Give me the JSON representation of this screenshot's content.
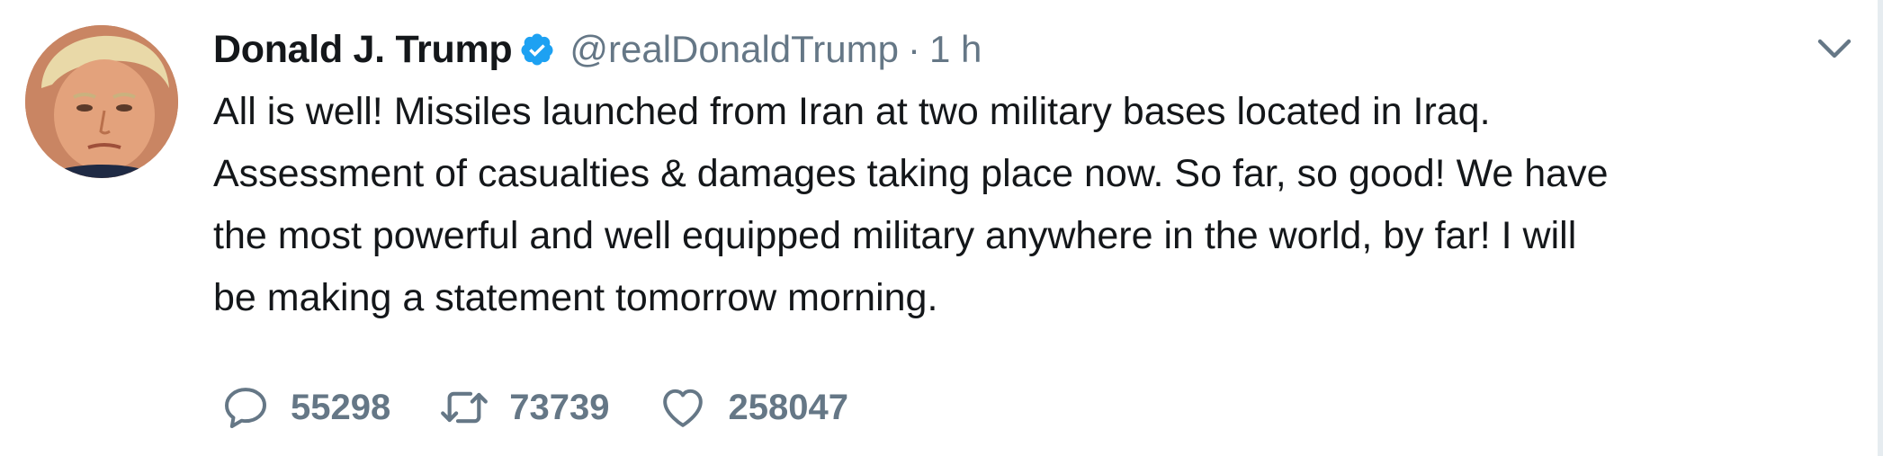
{
  "tweet": {
    "author_name": "Donald J. Trump",
    "handle": "@realDonaldTrump",
    "separator": "·",
    "time": "1 h",
    "text_lines": [
      "All is well! Missiles launched from Iran at two military bases located in Iraq.",
      "Assessment of casualties & damages taking place now. So far, so good! We have",
      "the most powerful and well equipped military anywhere in the world, by far! I will",
      "be making a statement tomorrow morning."
    ],
    "replies": "55298",
    "retweets": "73739",
    "likes": "258047"
  },
  "icons": {
    "verified": "verified-badge-icon",
    "caret": "chevron-down-icon",
    "reply": "reply-bubble-icon",
    "retweet": "retweet-arrows-icon",
    "like": "heart-icon"
  },
  "colors": {
    "text_primary": "#14171a",
    "text_secondary": "#657786",
    "verified_blue": "#1da1f2",
    "divider": "#e6ecf0"
  }
}
